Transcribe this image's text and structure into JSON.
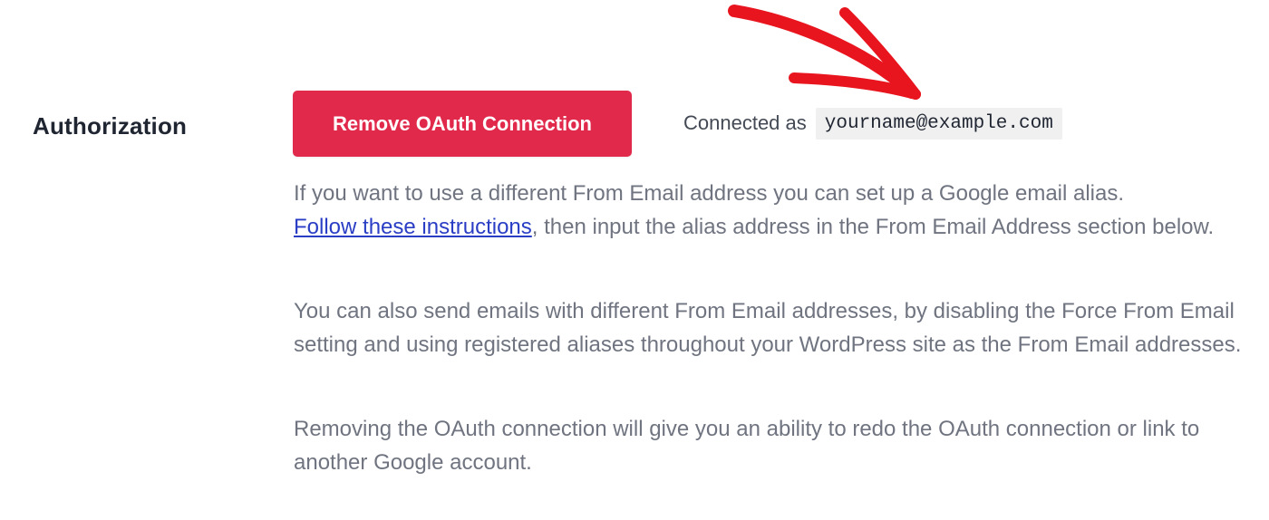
{
  "authorization": {
    "label": "Authorization",
    "remove_button": "Remove OAuth Connection",
    "connected_prefix": "Connected as",
    "connected_email": "yourname@example.com"
  },
  "descriptions": {
    "p1_text_before_line_break": "If you want to use a different From Email address you can set up a Google email alias.",
    "p1_link": "Follow these instructions",
    "p1_text_after_link": ", then input the alias address in the From Email Address section below.",
    "p2": "You can also send emails with different From Email addresses, by disabling the Force From Email setting and using registered aliases throughout your WordPress site as the From Email addresses.",
    "p3": "Removing the OAuth connection will give you an ability to redo the OAuth connection or link to another Google account."
  },
  "colors": {
    "button_bg": "#e1294b",
    "arrow": "#e8141e",
    "link": "#2a3ec5",
    "body_text": "#6f7480",
    "label_text": "#1f2531"
  },
  "icons": {
    "annotation": "red-arrow-icon"
  }
}
